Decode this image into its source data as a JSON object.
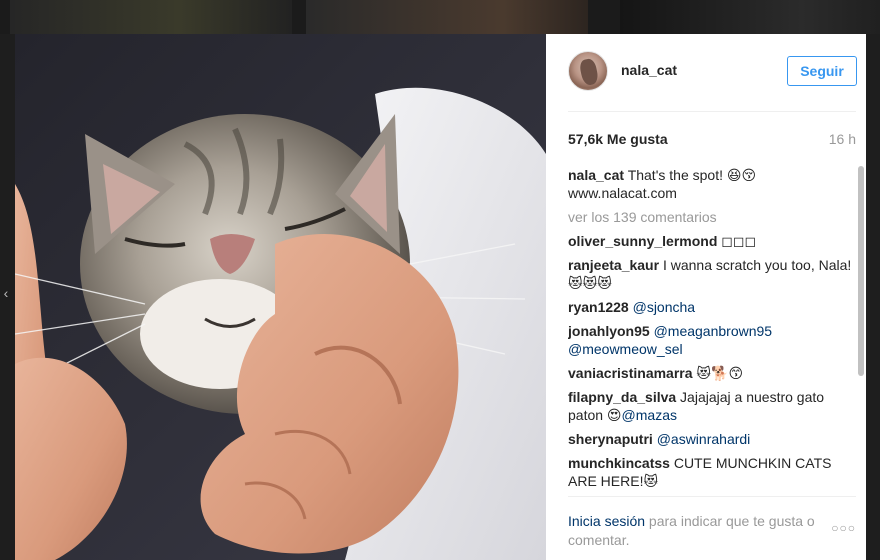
{
  "post": {
    "username": "nala_cat",
    "follow_label": "Seguir",
    "likes": "57,6k Me gusta",
    "time_ago": "16 h",
    "caption": {
      "user": "nala_cat",
      "text": "That's the spot! 😆😚",
      "link": "www.nalacat.com"
    },
    "load_more": "ver los 139 comentarios",
    "comments": [
      {
        "user": "oliver_sunny_lermond",
        "text": " ◻◻◻",
        "mention": ""
      },
      {
        "user": "ranjeeta_kaur",
        "text": " I wanna scratch you too, Nala! 😻😻😻",
        "mention": ""
      },
      {
        "user": "ryan1228",
        "text": " ",
        "mention": "@sjoncha"
      },
      {
        "user": "jonahlyon95",
        "text": " ",
        "mention": "@meaganbrown95 @meowmeow_sel"
      },
      {
        "user": "vaniacristinamarra",
        "text": " 😻🐕😙",
        "mention": ""
      },
      {
        "user": "filapny_da_silva",
        "text": " Jajajajaj a nuestro gato paton 😍",
        "mention": "@mazas"
      },
      {
        "user": "sherynaputri",
        "text": " ",
        "mention": "@aswinrahardi"
      },
      {
        "user": "munchkincatss",
        "text": " CUTE MUNCHKIN CATS ARE HERE!😻",
        "mention": ""
      }
    ],
    "footer": {
      "login_link": "Inicia sesión",
      "login_rest": " para indicar que te gusta o comentar.",
      "more_label": "○○○"
    }
  },
  "nav": {
    "prev_arrow": "‹"
  },
  "colors": {
    "accent": "#3897f0",
    "mention": "#003569",
    "muted": "#999999"
  }
}
